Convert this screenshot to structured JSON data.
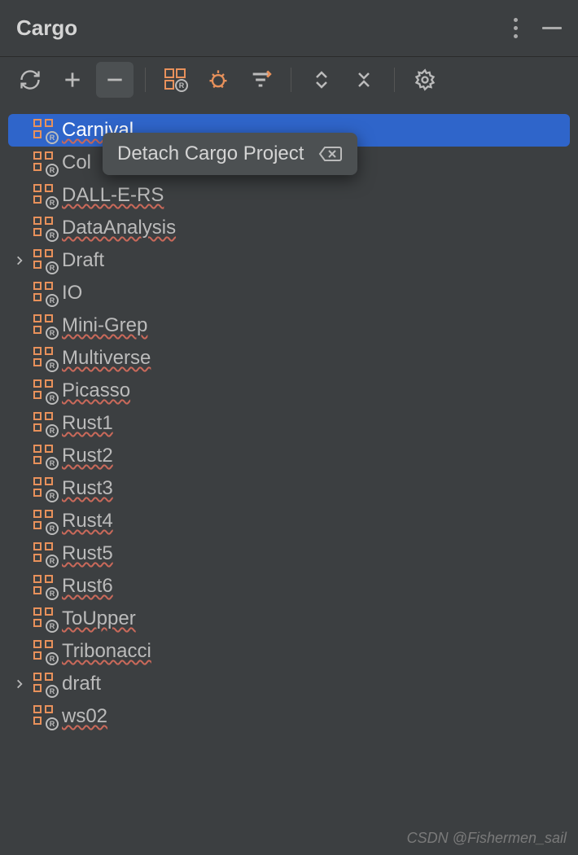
{
  "title": "Cargo",
  "context_menu": {
    "label": "Detach Cargo Project"
  },
  "projects": [
    {
      "name": "Carnival",
      "wavy": true,
      "selected": true,
      "expandable": false
    },
    {
      "name": "Col",
      "wavy": false,
      "selected": false,
      "expandable": false
    },
    {
      "name": "DALL-E-RS",
      "wavy": true,
      "selected": false,
      "expandable": false
    },
    {
      "name": "DataAnalysis",
      "wavy": true,
      "selected": false,
      "expandable": false
    },
    {
      "name": "Draft",
      "wavy": false,
      "selected": false,
      "expandable": true
    },
    {
      "name": "IO",
      "wavy": false,
      "selected": false,
      "expandable": false
    },
    {
      "name": "Mini-Grep",
      "wavy": true,
      "selected": false,
      "expandable": false
    },
    {
      "name": "Multiverse",
      "wavy": true,
      "selected": false,
      "expandable": false
    },
    {
      "name": "Picasso",
      "wavy": true,
      "selected": false,
      "expandable": false
    },
    {
      "name": "Rust1",
      "wavy": true,
      "selected": false,
      "expandable": false
    },
    {
      "name": "Rust2",
      "wavy": true,
      "selected": false,
      "expandable": false
    },
    {
      "name": "Rust3",
      "wavy": true,
      "selected": false,
      "expandable": false
    },
    {
      "name": "Rust4",
      "wavy": true,
      "selected": false,
      "expandable": false
    },
    {
      "name": "Rust5",
      "wavy": true,
      "selected": false,
      "expandable": false
    },
    {
      "name": "Rust6",
      "wavy": true,
      "selected": false,
      "expandable": false
    },
    {
      "name": "ToUpper",
      "wavy": true,
      "selected": false,
      "expandable": false
    },
    {
      "name": "Tribonacci",
      "wavy": true,
      "selected": false,
      "expandable": false
    },
    {
      "name": "draft",
      "wavy": false,
      "selected": false,
      "expandable": true
    },
    {
      "name": "ws02",
      "wavy": true,
      "selected": false,
      "expandable": false
    }
  ],
  "watermark": "CSDN @Fishermen_sail"
}
